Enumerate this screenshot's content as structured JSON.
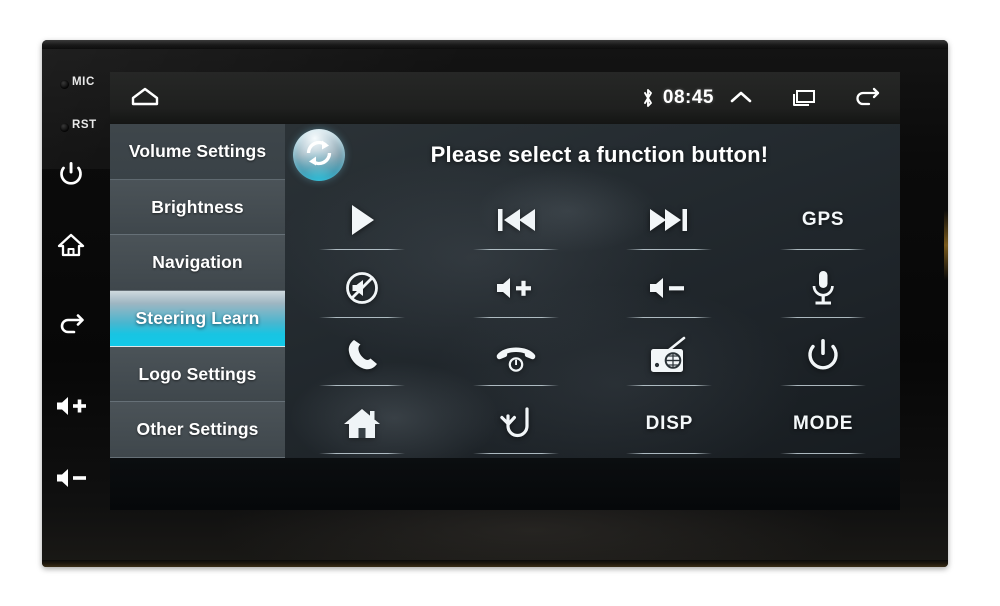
{
  "device": {
    "indicators": [
      {
        "name": "mic",
        "label": "MIC"
      },
      {
        "name": "rst",
        "label": "RST"
      }
    ],
    "buttons": [
      {
        "name": "power",
        "icon": "power-icon"
      },
      {
        "name": "home",
        "icon": "home-icon"
      },
      {
        "name": "back",
        "icon": "back-arrow-icon"
      },
      {
        "name": "volume-up",
        "icon": "volume-up-icon"
      },
      {
        "name": "volume-down",
        "icon": "volume-down-icon"
      }
    ]
  },
  "statusbar": {
    "home_icon": "home-outline-icon",
    "bluetooth_icon": "bluetooth-icon",
    "time": "08:45",
    "expand_icon": "chevron-up-icon",
    "recents_icon": "recent-apps-icon",
    "back_icon": "back-arrow-icon"
  },
  "sidebar": {
    "items": [
      {
        "label": "Volume Settings",
        "selected": false
      },
      {
        "label": "Brightness",
        "selected": false
      },
      {
        "label": "Navigation",
        "selected": false
      },
      {
        "label": "Steering Learn",
        "selected": true
      },
      {
        "label": "Logo Settings",
        "selected": false
      },
      {
        "label": "Other Settings",
        "selected": false
      }
    ],
    "selected_color": "#12c8e8"
  },
  "panel": {
    "refresh_icon": "refresh-circle-icon",
    "title": "Please select a function button!",
    "functions": [
      {
        "name": "play",
        "icon": "play-icon",
        "label": ""
      },
      {
        "name": "previous-track",
        "icon": "previous-track-icon",
        "label": ""
      },
      {
        "name": "next-track",
        "icon": "next-track-icon",
        "label": ""
      },
      {
        "name": "gps",
        "icon": "text-label",
        "label": "GPS"
      },
      {
        "name": "mute",
        "icon": "mute-icon",
        "label": ""
      },
      {
        "name": "volume-up",
        "icon": "volume-up-icon",
        "label": ""
      },
      {
        "name": "volume-down",
        "icon": "volume-down-icon",
        "label": ""
      },
      {
        "name": "voice",
        "icon": "microphone-icon",
        "label": ""
      },
      {
        "name": "answer-call",
        "icon": "phone-answer-icon",
        "label": ""
      },
      {
        "name": "end-call",
        "icon": "phone-hangup-icon",
        "label": ""
      },
      {
        "name": "radio",
        "icon": "radio-icon",
        "label": ""
      },
      {
        "name": "power",
        "icon": "power-icon",
        "label": ""
      },
      {
        "name": "home",
        "icon": "house-icon",
        "label": ""
      },
      {
        "name": "back",
        "icon": "return-arrow-icon",
        "label": ""
      },
      {
        "name": "disp",
        "icon": "text-label",
        "label": "DISP"
      },
      {
        "name": "mode",
        "icon": "text-label",
        "label": "MODE"
      }
    ]
  }
}
